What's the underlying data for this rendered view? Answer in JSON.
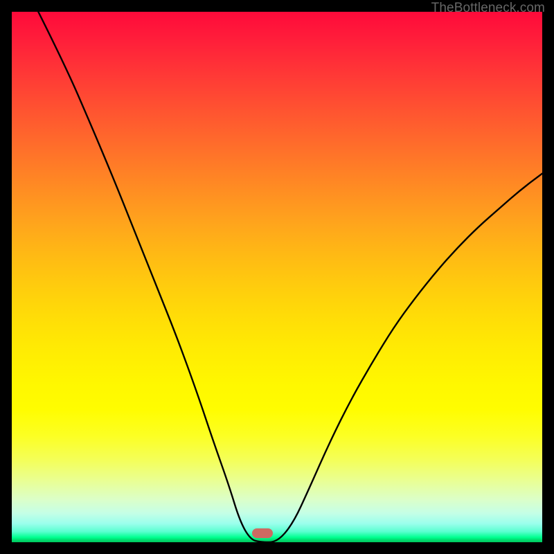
{
  "watermark": "TheBottleneck.com",
  "marker": {
    "x_frac": 0.473,
    "y_frac": 0.983
  },
  "chart_data": {
    "type": "line",
    "title": "",
    "xlabel": "",
    "ylabel": "",
    "xlim": [
      0,
      1
    ],
    "ylim": [
      0,
      1
    ],
    "grid": false,
    "legend": false,
    "annotations": [
      "TheBottleneck.com"
    ],
    "background": "red-yellow-green vertical gradient (bottleneck heatmap)",
    "series": [
      {
        "name": "bottleneck-curve",
        "x": [
          0.0,
          0.05,
          0.1,
          0.15,
          0.19,
          0.23,
          0.27,
          0.31,
          0.35,
          0.38,
          0.41,
          0.43,
          0.45,
          0.47,
          0.5,
          0.53,
          0.56,
          0.6,
          0.64,
          0.68,
          0.72,
          0.76,
          0.8,
          0.84,
          0.88,
          0.92,
          0.96,
          1.0
        ],
        "y": [
          null,
          1.0,
          0.9,
          0.785,
          0.69,
          0.59,
          0.49,
          0.39,
          0.28,
          0.19,
          0.105,
          0.04,
          0.005,
          0.0,
          0.0,
          0.035,
          0.1,
          0.19,
          0.27,
          0.34,
          0.405,
          0.46,
          0.51,
          0.555,
          0.595,
          0.63,
          0.665,
          0.695
        ],
        "note": "y is fraction of plot height from bottom; left branch starts above top (enters at x≈0.05)."
      }
    ],
    "marker": {
      "x": 0.473,
      "y": 0.0,
      "color": "#cc6a62",
      "shape": "pill"
    }
  }
}
